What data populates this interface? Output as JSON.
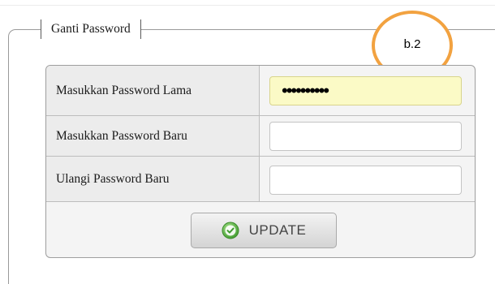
{
  "legend": {
    "title": "Ganti Password"
  },
  "annotation": {
    "label": "b.2"
  },
  "form": {
    "rows": [
      {
        "label": "Masukkan Password Lama",
        "value": "••••••••••"
      },
      {
        "label": "Masukkan Password Baru",
        "value": ""
      },
      {
        "label": "Ulangi Password Baru",
        "value": ""
      }
    ],
    "submit_label": "UPDATE",
    "submit_icon": "check-circle-icon"
  },
  "colors": {
    "annotation_ring": "#f2a240",
    "focused_field": "#fbfac6",
    "check_icon": "#4caf50"
  }
}
